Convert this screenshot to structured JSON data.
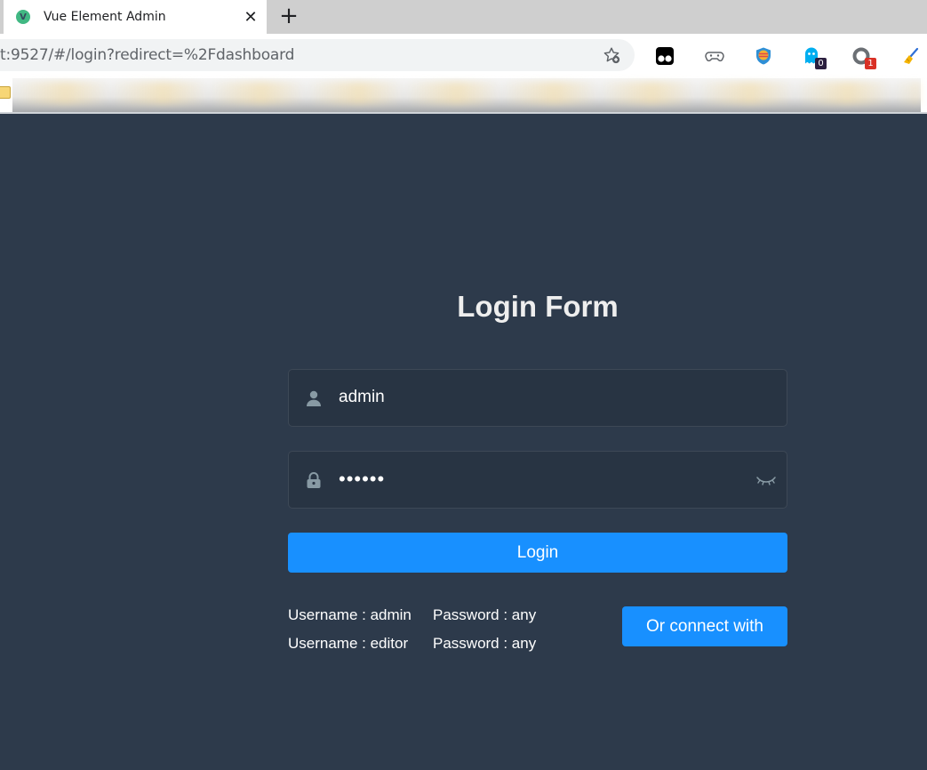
{
  "browser": {
    "tab": {
      "title": "Vue Element Admin",
      "favicon_letter": "V",
      "close_glyph": "✕"
    },
    "new_tab_glyph": "+",
    "address_bar": {
      "url": "t:9527/#/login?redirect=%2Fdashboard"
    },
    "extensions": [
      {
        "name": "tampermonkey-icon"
      },
      {
        "name": "gamepad-icon"
      },
      {
        "name": "globe-shield-icon"
      },
      {
        "name": "ghostery-icon",
        "badge": "0"
      },
      {
        "name": "opera-ring-icon",
        "badge": "1"
      },
      {
        "name": "broom-icon"
      }
    ]
  },
  "login": {
    "title": "Login Form",
    "username": {
      "value": "admin"
    },
    "password": {
      "value": "••••••"
    },
    "submit_label": "Login",
    "connect_label": "Or connect with",
    "tips": [
      {
        "username": "Username : admin",
        "password": "Password : any"
      },
      {
        "username": "Username : editor",
        "password": "Password : any"
      }
    ]
  },
  "colors": {
    "background": "#2d3a4b",
    "input_bg": "#283443",
    "primary": "#1890ff"
  }
}
